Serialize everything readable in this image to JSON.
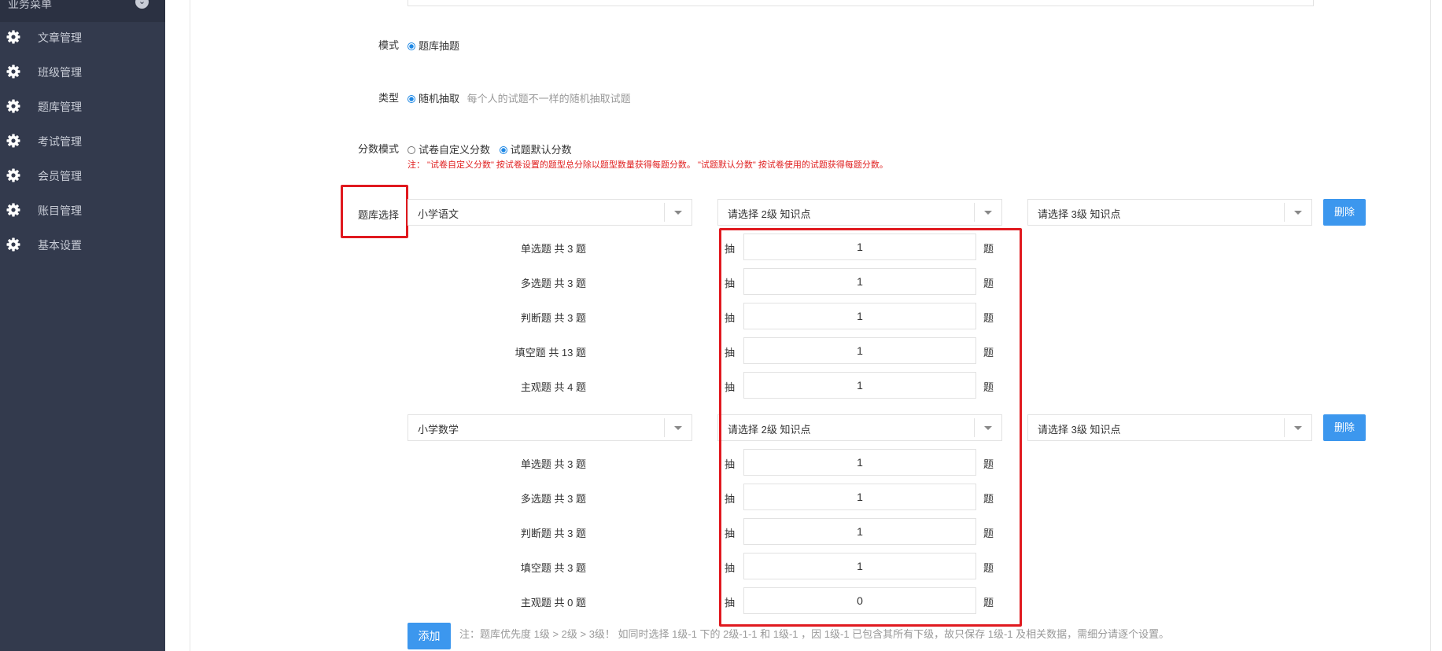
{
  "sidebar": {
    "header": "业务菜单",
    "items": [
      {
        "label": "文章管理",
        "icon": "gear-icon"
      },
      {
        "label": "班级管理",
        "icon": "gear-icon"
      },
      {
        "label": "题库管理",
        "icon": "gear-icon"
      },
      {
        "label": "考试管理",
        "icon": "gear-icon"
      },
      {
        "label": "会员管理",
        "icon": "gear-icon"
      },
      {
        "label": "账目管理",
        "icon": "gear-icon"
      },
      {
        "label": "基本设置",
        "icon": "gear-icon"
      }
    ]
  },
  "form": {
    "mode": {
      "label": "模式",
      "option": "题库抽题",
      "selected": true
    },
    "type": {
      "label": "类型",
      "option": "随机抽取",
      "hint": "每个人的试题不一样的随机抽取试题",
      "selected": true
    },
    "score_mode": {
      "label": "分数模式",
      "options": [
        {
          "label": "试卷自定义分数",
          "selected": false
        },
        {
          "label": "试题默认分数",
          "selected": true
        }
      ],
      "note": "注：  \"试卷自定义分数\" 按试卷设置的题型总分除以题型数量获得每题分数。  \"试题默认分数\" 按试卷使用的试题获得每题分数。"
    },
    "bank_select": {
      "label": "题库选择"
    },
    "chou": "抽",
    "ti": "题",
    "banks": [
      {
        "level1": "小学语文",
        "level2_placeholder": "请选择 2级 知识点",
        "level3_placeholder": "请选择 3级 知识点",
        "delete_label": "删除",
        "questions": [
          {
            "label": "单选题 共 3 题",
            "count": "1"
          },
          {
            "label": "多选题 共 3 题",
            "count": "1"
          },
          {
            "label": "判断题 共 3 题",
            "count": "1"
          },
          {
            "label": "填空题 共 13 题",
            "count": "1"
          },
          {
            "label": "主观题 共 4 题",
            "count": "1"
          }
        ]
      },
      {
        "level1": "小学数学",
        "level2_placeholder": "请选择 2级 知识点",
        "level3_placeholder": "请选择 3级 知识点",
        "delete_label": "删除",
        "questions": [
          {
            "label": "单选题 共 3 题",
            "count": "1"
          },
          {
            "label": "多选题 共 3 题",
            "count": "1"
          },
          {
            "label": "判断题 共 3 题",
            "count": "1"
          },
          {
            "label": "填空题 共 3 题",
            "count": "1"
          },
          {
            "label": "主观题 共 0 题",
            "count": "0"
          }
        ]
      }
    ],
    "add_label": "添加",
    "add_note": "注：题库优先度 1级 > 2级 > 3级！ 如同时选择 1级-1 下的 2级-1-1 和 1级-1 ，因 1级-1 已包含其所有下级，故只保存 1级-1 及相关数据，需细分请逐个设置。"
  },
  "colors": {
    "sidebar_bg": "#333a4d",
    "primary": "#3c97ee",
    "highlight": "#e0191f",
    "note_red": "#e02020"
  }
}
